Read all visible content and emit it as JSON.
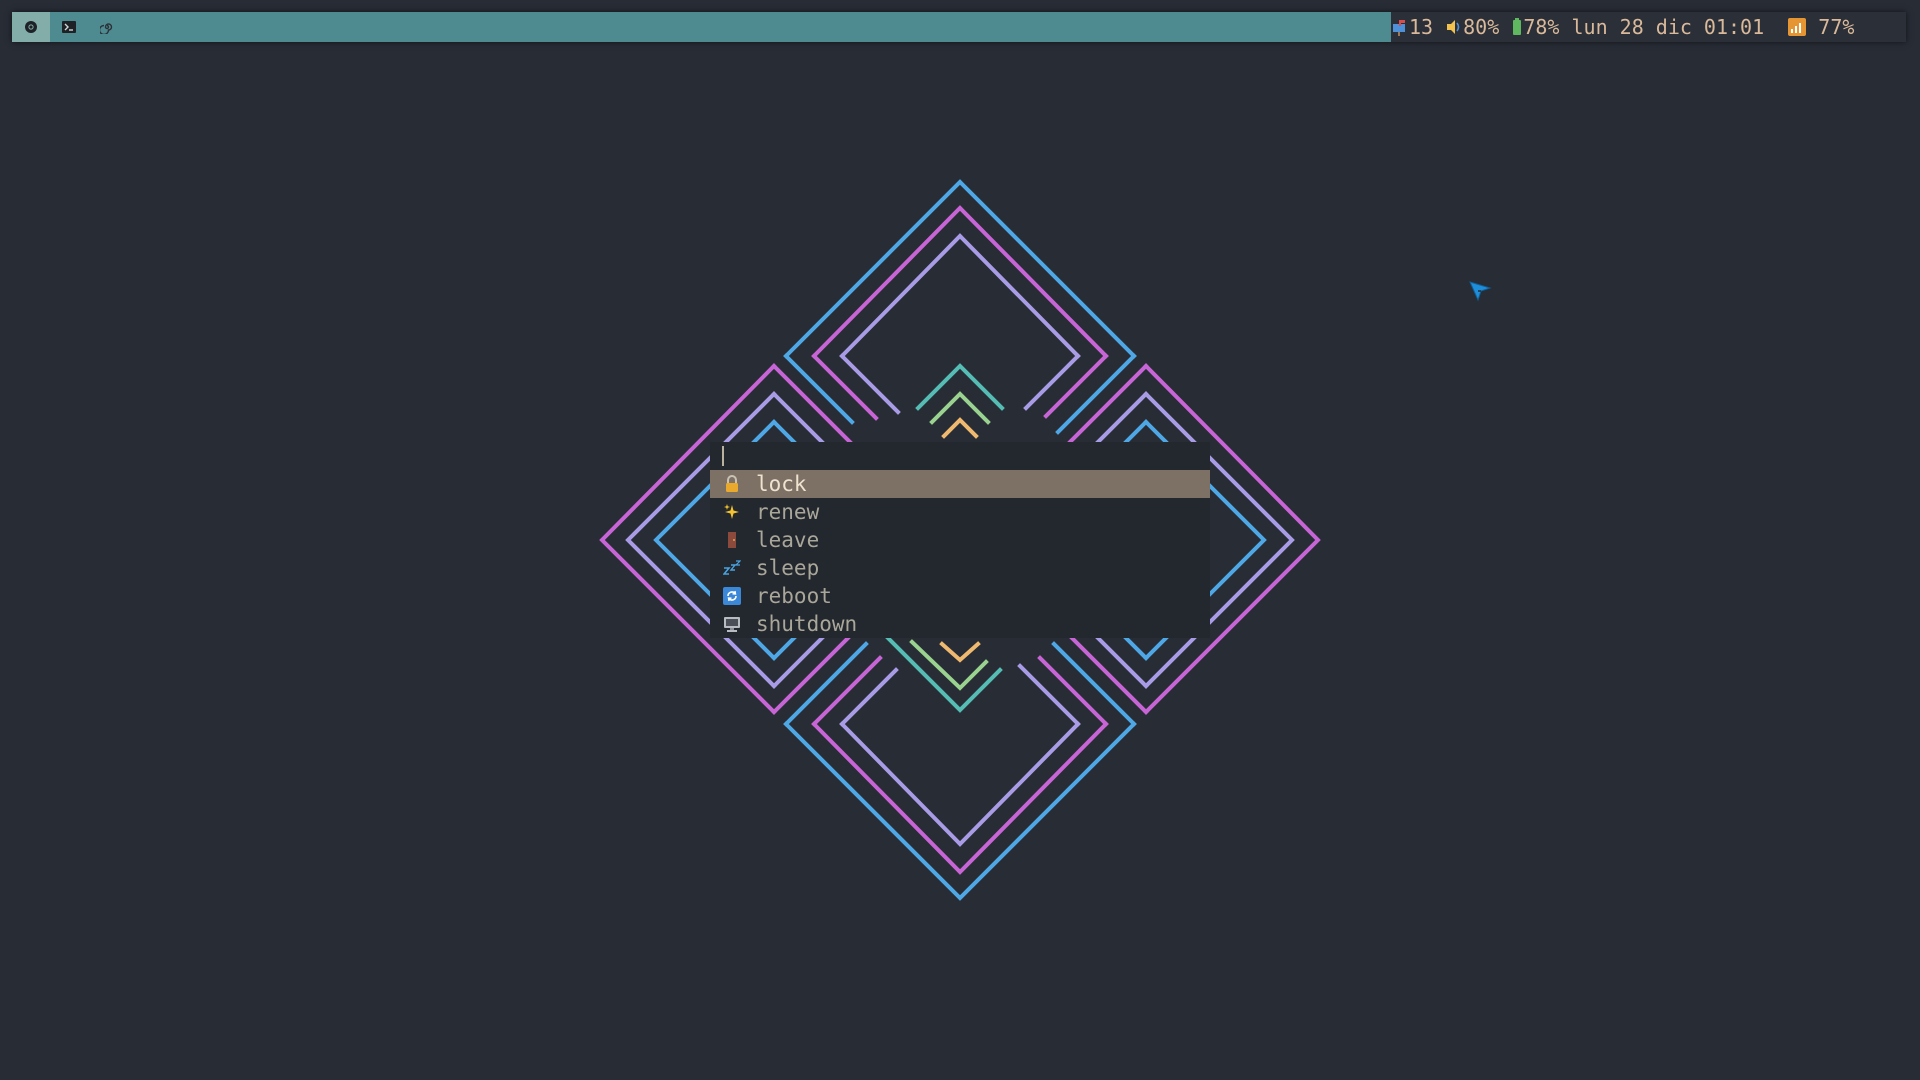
{
  "bar": {
    "workspaces": [
      {
        "icon": "chrome-icon",
        "active": true
      },
      {
        "icon": "terminal-icon",
        "active": false
      },
      {
        "icon": "spiral-icon",
        "active": false
      }
    ],
    "status": {
      "notifications": "13",
      "volume": "80%",
      "battery": "78%",
      "datetime": "lun 28 dic 01:01",
      "wifi": "77%"
    }
  },
  "menu": {
    "query": "",
    "items": [
      {
        "label": "lock",
        "icon": "lock-icon"
      },
      {
        "label": "renew",
        "icon": "sparkles-icon"
      },
      {
        "label": "leave",
        "icon": "door-icon"
      },
      {
        "label": "sleep",
        "icon": "zzz-icon"
      },
      {
        "label": "reboot",
        "icon": "refresh-icon"
      },
      {
        "label": "shutdown",
        "icon": "computer-icon"
      }
    ],
    "selected": 0
  },
  "colors": {
    "background": "#282c35",
    "bar_accent": "#4e8b91",
    "blue": "#4fa8e6",
    "magenta": "#c765d6",
    "lavender": "#a99ce6",
    "teal": "#55bdb4",
    "green": "#9ad28f",
    "orange": "#f0b970",
    "selected_item": "#7d7166"
  }
}
